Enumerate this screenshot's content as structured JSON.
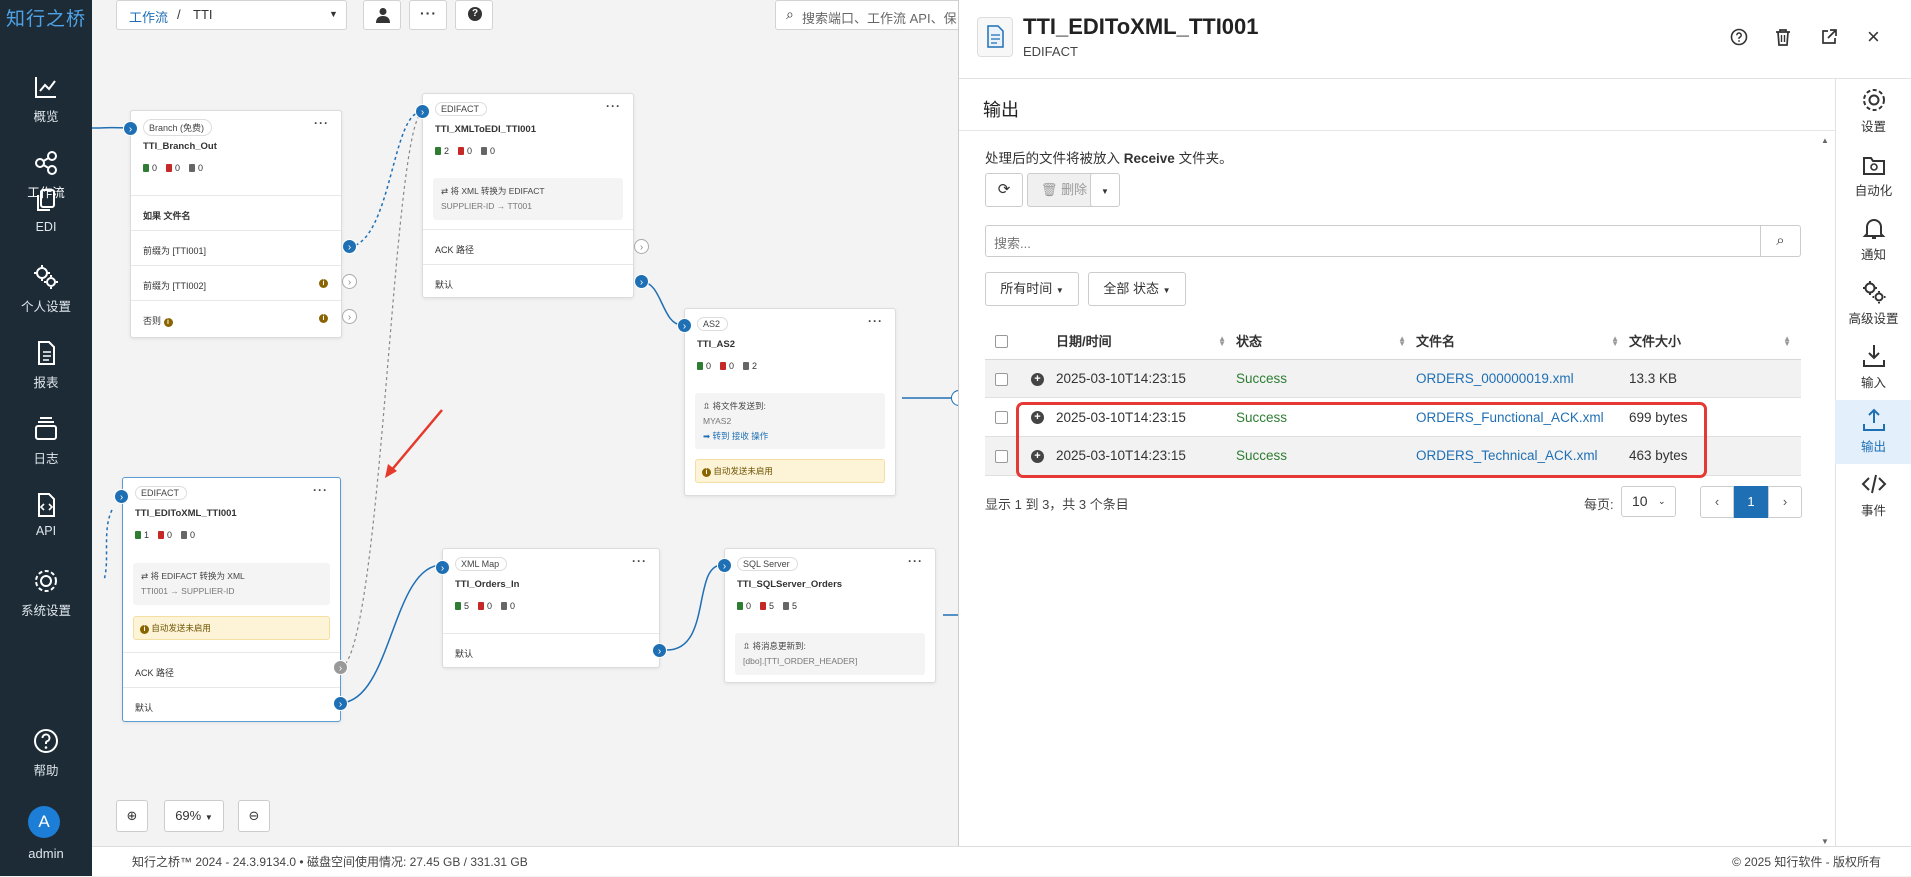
{
  "nav": {
    "logo": "知行之桥",
    "items": [
      {
        "label": "概览",
        "icon": "chart-line-icon"
      },
      {
        "label": "工作流",
        "icon": "share-nodes-icon"
      },
      {
        "label": "EDI",
        "icon": "copy-icon"
      },
      {
        "label": "个人设置",
        "icon": "gears-icon"
      },
      {
        "label": "报表",
        "icon": "file-icon"
      },
      {
        "label": "日志",
        "icon": "layers-icon"
      },
      {
        "label": "API",
        "icon": "file-code-icon"
      },
      {
        "label": "系统设置",
        "icon": "gear-icon"
      },
      {
        "label": "帮助",
        "icon": "help-circle-icon"
      }
    ],
    "user": {
      "initial": "A",
      "name": "admin"
    }
  },
  "toolbar": {
    "breadcrumb_root": "工作流",
    "separator": "/",
    "breadcrumb_current": "TTI",
    "search_placeholder": "搜索端口、工作流 API、保"
  },
  "nodes": {
    "branch": {
      "tag": "Branch (免费)",
      "title": "TTI_Branch_Out",
      "counts": [
        "0",
        "0",
        "0"
      ],
      "header_label": "如果 文件名",
      "rows": [
        "前缀为 [TTI001]",
        "前缀为 [TTI002]",
        "否则"
      ]
    },
    "xml_to_edi": {
      "tag": "EDIFACT",
      "title": "TTI_XMLToEDI_TTI001",
      "counts": [
        "2",
        "0",
        "0"
      ],
      "box_line1": "⇄ 将 XML 转换为 EDIFACT",
      "box_line2": "SUPPLIER-ID → TT001",
      "rows": [
        "ACK 路径",
        "默认"
      ]
    },
    "as2": {
      "tag": "AS2",
      "title": "TTI_AS2",
      "counts": [
        "0",
        "0",
        "2"
      ],
      "box_line1": "⇫ 将文件发送到:",
      "box_line2": "MYAS2",
      "box_link": "➡ 转到 接收 操作",
      "warn": "自动发送未启用"
    },
    "edi_to_xml": {
      "tag": "EDIFACT",
      "title": "TTI_EDIToXML_TTI001",
      "counts": [
        "1",
        "0",
        "0"
      ],
      "box_line1": "⇄ 将 EDIFACT 转换为 XML",
      "box_line2": "TTI001 → SUPPLIER-ID",
      "warn": "自动发送未启用",
      "rows": [
        "ACK 路径",
        "默认"
      ]
    },
    "xml_map": {
      "tag": "XML Map",
      "title": "TTI_Orders_In",
      "counts": [
        "5",
        "0",
        "0"
      ],
      "rows": [
        "默认"
      ]
    },
    "sql": {
      "tag": "SQL Server",
      "title": "TTI_SQLServer_Orders",
      "counts": [
        "0",
        "5",
        "5"
      ],
      "box_line1": "⇫ 将消息更新到:",
      "box_line2": "[dbo].[TTI_ORDER_HEADER]"
    }
  },
  "zoom": {
    "level": "69%"
  },
  "footer": {
    "left": "知行之桥™ 2024 - 24.3.9134.0 • 磁盘空间使用情况: 27.45 GB / 331.31 GB",
    "right": "© 2025 知行软件 - 版权所有"
  },
  "panel": {
    "title": "TTI_EDIToXML_TTI001",
    "subtitle": "EDIFACT",
    "section_title": "输出",
    "info_prefix": "处理后的文件将被放入",
    "info_folder": "Receive",
    "info_suffix": "文件夹。",
    "delete_label": "删除",
    "search_placeholder": "搜索...",
    "filter_time": "所有时间",
    "filter_status": "全部 状态",
    "columns": [
      "日期/时间",
      "状态",
      "文件名",
      "文件大小"
    ],
    "rows": [
      {
        "datetime": "2025-03-10T14:23:15",
        "status": "Success",
        "filename": "ORDERS_000000019.xml",
        "size": "13.3 KB"
      },
      {
        "datetime": "2025-03-10T14:23:15",
        "status": "Success",
        "filename": "ORDERS_Functional_ACK.xml",
        "size": "699 bytes"
      },
      {
        "datetime": "2025-03-10T14:23:15",
        "status": "Success",
        "filename": "ORDERS_Technical_ACK.xml",
        "size": "463 bytes"
      }
    ],
    "summary": "显示 1 到 3，共 3 个条目",
    "per_page_label": "每页:",
    "per_page_value": "10",
    "current_page": "1",
    "highlight_color": "#e53935"
  },
  "side_actions": [
    {
      "label": "设置",
      "icon": "gear-icon"
    },
    {
      "label": "自动化",
      "icon": "automation-icon"
    },
    {
      "label": "通知",
      "icon": "bell-icon"
    },
    {
      "label": "高级设置",
      "icon": "gears-icon"
    },
    {
      "label": "输入",
      "icon": "download-icon"
    },
    {
      "label": "输出",
      "icon": "upload-icon"
    },
    {
      "label": "事件",
      "icon": "code-icon"
    }
  ],
  "colors": {
    "primary": "#1f6fb5",
    "nav_bg": "#1d2b36",
    "success": "#2e7d32"
  }
}
